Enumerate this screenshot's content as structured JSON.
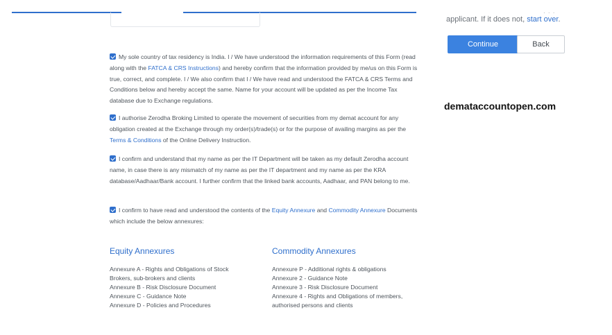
{
  "side": {
    "partial_text": "· · ·",
    "text": "applicant. If it does not, ",
    "start_over": "start over",
    "period": "."
  },
  "buttons": {
    "continue": "Continue",
    "back": "Back"
  },
  "watermark": "demataccountopen.com",
  "consents": [
    {
      "checked": true,
      "parts": [
        "My sole country of tax residency is India. I / We have understood the information requirements of this Form (read along with the ",
        "FATCA & CRS Instructions",
        ") and hereby confirm that the information provided by me/us on this Form is true, correct, and complete. I / We also confirm that I / We have read and understood the FATCA & CRS Terms and Conditions below and hereby accept the same. Name for your account will be updated as per the Income Tax database due to Exchange regulations."
      ]
    },
    {
      "checked": true,
      "parts": [
        "I authorise Zerodha Broking Limited to operate the movement of securities from my demat account for any obligation created at the Exchange through my order(s)/trade(s) or for the purpose of availing margins as per the ",
        "Terms & Conditions",
        " of the Online Delivery Instruction."
      ]
    },
    {
      "checked": true,
      "parts": [
        "I confirm and understand that my name as per the IT Department will be taken as my default Zerodha account name, in case there is any mismatch of my name as per the IT department and my name as per the KRA database/Aadhaar/Bank account. I further confirm that the linked bank accounts, Aadhaar, and PAN belong to me."
      ]
    },
    {
      "checked": true,
      "parts": [
        "I confirm to have read and understood the contents of the ",
        "Equity Annexure",
        " and ",
        "Commodity Annexure",
        " Documents which include the below annexures:"
      ]
    }
  ],
  "equity": {
    "title": "Equity Annexures",
    "items": [
      "Annexure A - Rights and Obligations of Stock",
      "Brokers, sub-brokers and clients",
      "Annexure B - Risk Disclosure Document",
      "Annexure C - Guidance Note",
      "Annexure D - Policies and Procedures"
    ]
  },
  "commodity": {
    "title": "Commodity Annexures",
    "items": [
      "Annexure P - Additional rights & obligations",
      "Annexure 2 - Guidance Note",
      "Annexure 3 - Risk Disclosure Document",
      "Annexure 4 - Rights and Obligations of members,",
      "authorised persons and clients"
    ]
  },
  "colors": {
    "accent": "#2f6fcc",
    "button": "#3b82e0",
    "text": "#4e555c"
  }
}
